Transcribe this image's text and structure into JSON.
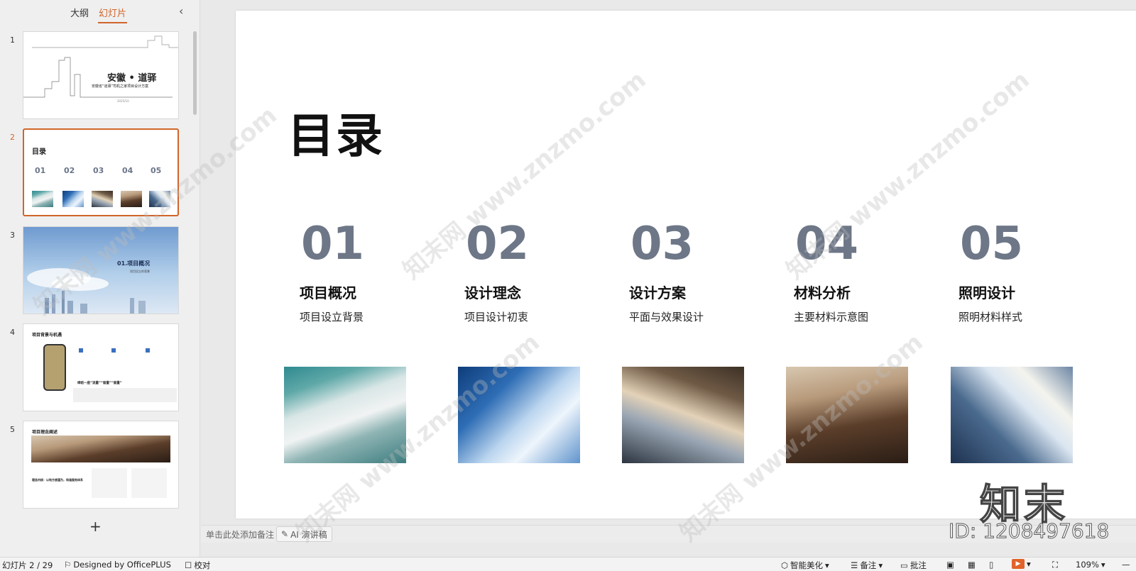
{
  "left_panel": {
    "tabs": [
      "大纲",
      "幻灯片"
    ],
    "active_tab": "幻灯片",
    "thumbnails": [
      {
        "number": "1",
        "title": "安徽 • 道驿",
        "subtitle": "安徽省“道驿”司机之家项目设计方案",
        "date": "2025/10"
      },
      {
        "number": "2",
        "title": "目录",
        "numbers": [
          "01",
          "02",
          "03",
          "04",
          "05"
        ]
      },
      {
        "number": "3",
        "title": "01.项目概况",
        "subtitle": "项目设立的背景"
      },
      {
        "number": "4",
        "title": "项目背景与机遇",
        "banner": "缔结一座“流量”“留量”“留量”"
      },
      {
        "number": "5",
        "title": "项目理念阐述",
        "subtitle": "理念内核：以地方底蕴为，和谐服务体系"
      }
    ],
    "add_slide_symbol": "+"
  },
  "slide": {
    "title": "目录",
    "items": [
      {
        "num": "01",
        "title": "项目概况",
        "subtitle": "项目设立背景"
      },
      {
        "num": "02",
        "title": "设计理念",
        "subtitle": "项目设计初衷"
      },
      {
        "num": "03",
        "title": "设计方案",
        "subtitle": "平面与效果设计"
      },
      {
        "num": "04",
        "title": "材料分析",
        "subtitle": "主要材料示意图"
      },
      {
        "num": "05",
        "title": "照明设计",
        "subtitle": "照明材料样式"
      }
    ]
  },
  "notes": {
    "placeholder": "单击此处添加备注",
    "ai_button": "AI 演讲稿"
  },
  "status_bar": {
    "slide_counter": "幻灯片 2 / 29",
    "designed_by": "Designed by OfficePLUS",
    "proofread": "校对",
    "smart_beautify": "智能美化",
    "notes": "备注",
    "comments": "批注",
    "zoom": "109%"
  },
  "watermark": {
    "text": "知末网 www.znzmo.com",
    "logo": "知末",
    "id": "ID: 1208497618"
  },
  "colors": {
    "accent": "#d0652a",
    "number_gray": "#6d7787"
  }
}
